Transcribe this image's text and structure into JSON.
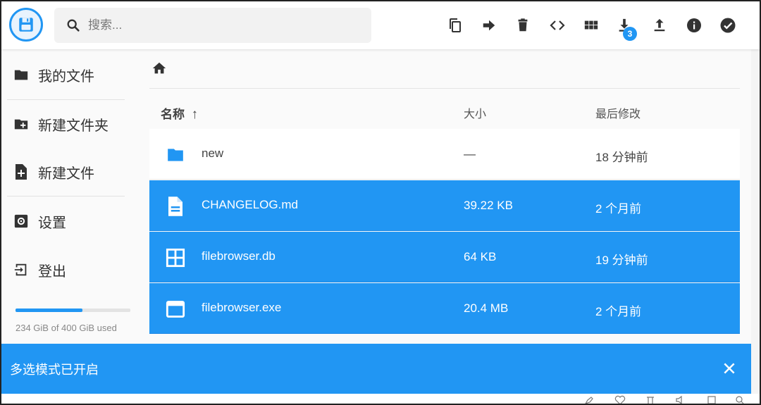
{
  "header": {
    "search_placeholder": "搜索...",
    "download_badge": "3",
    "toolbar": [
      {
        "name": "copy-icon"
      },
      {
        "name": "move-icon"
      },
      {
        "name": "delete-icon"
      },
      {
        "name": "code-icon"
      },
      {
        "name": "grid-view-icon"
      },
      {
        "name": "download-icon"
      },
      {
        "name": "upload-icon"
      },
      {
        "name": "info-icon"
      },
      {
        "name": "select-check-icon"
      }
    ]
  },
  "sidebar": {
    "items": [
      {
        "label": "我的文件",
        "icon": "folder-icon"
      },
      {
        "label": "新建文件夹",
        "icon": "new-folder-icon"
      },
      {
        "label": "新建文件",
        "icon": "new-file-icon"
      },
      {
        "label": "设置",
        "icon": "settings-icon"
      },
      {
        "label": "登出",
        "icon": "logout-icon"
      }
    ],
    "usage_text": "234 GiB of 400 GiB used",
    "usage_fraction": 0.585
  },
  "table": {
    "columns": {
      "name": "名称",
      "size": "大小",
      "modified": "最后修改"
    },
    "sort_arrow": "↑",
    "rows": [
      {
        "name": "new",
        "size": "—",
        "modified": "18 分钟前",
        "icon": "folder-icon",
        "selected": false
      },
      {
        "name": "CHANGELOG.md",
        "size": "39.22 KB",
        "modified": "2 个月前",
        "icon": "document-icon",
        "selected": true
      },
      {
        "name": "filebrowser.db",
        "size": "64 KB",
        "modified": "19 分钟前",
        "icon": "database-grid-icon",
        "selected": true
      },
      {
        "name": "filebrowser.exe",
        "size": "20.4 MB",
        "modified": "2 个月前",
        "icon": "executable-icon",
        "selected": true
      }
    ]
  },
  "snackbar": {
    "message": "多选模式已开启"
  },
  "colors": {
    "accent": "#2196f3"
  }
}
